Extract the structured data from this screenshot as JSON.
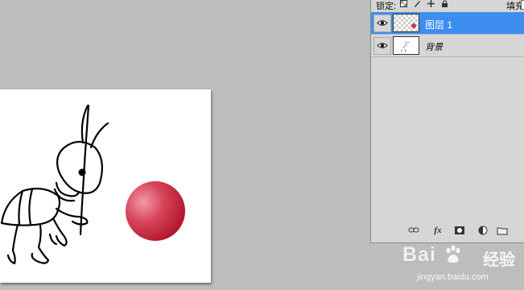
{
  "toolbar": {
    "lock_label": "锁定:",
    "fill_label": "填充:"
  },
  "layers": [
    {
      "name": "图层 1",
      "selected": true,
      "visible": true,
      "thumbnail": "transparent-with-red-sphere"
    },
    {
      "name": "背景",
      "selected": false,
      "visible": true,
      "thumbnail": "ant-sketch"
    }
  ],
  "panel_icons": [
    "link-icon",
    "fx-icon",
    "layer-mask-icon",
    "adjustment-layer-icon",
    "new-group-icon"
  ],
  "panel_icon_labels": {
    "fx": "fx"
  },
  "canvas": {
    "background": "#ffffff",
    "sphere_colors": {
      "highlight": "#f28a9a",
      "mid": "#d8455a",
      "shadow": "#b8152e"
    }
  },
  "colors": {
    "workspace_bg": "#bdbdbd",
    "panel_bg": "#d6d6d6",
    "selection": "#3d8ef0"
  },
  "watermark": {
    "brand": "Bai",
    "brand_suffix": "",
    "cn_text": "经验",
    "url": "jingyan.baidu.com"
  }
}
